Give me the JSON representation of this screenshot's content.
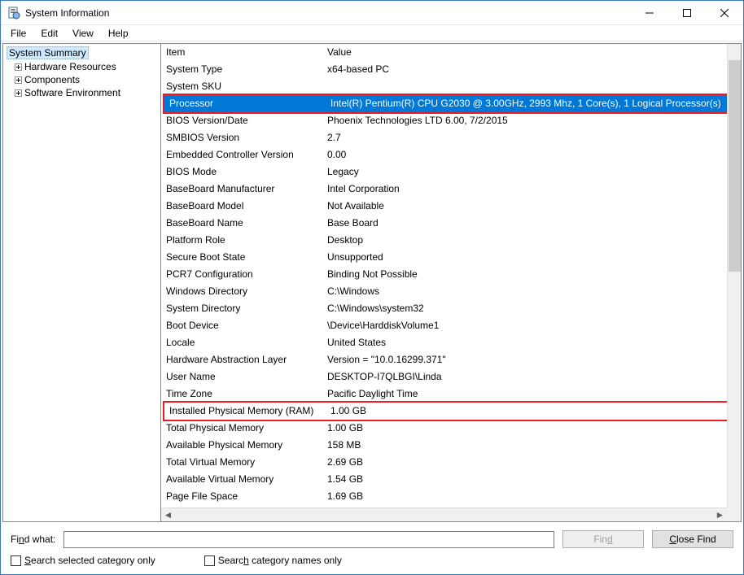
{
  "window": {
    "title": "System Information"
  },
  "menu": {
    "file": "File",
    "edit": "Edit",
    "view": "View",
    "help": "Help"
  },
  "tree": {
    "root": "System Summary",
    "children": [
      "Hardware Resources",
      "Components",
      "Software Environment"
    ]
  },
  "grid": {
    "header_item": "Item",
    "header_value": "Value",
    "rows": [
      {
        "item": "System Type",
        "value": "x64-based PC"
      },
      {
        "item": "System SKU",
        "value": ""
      },
      {
        "item": "Processor",
        "value": "Intel(R) Pentium(R) CPU G2030 @ 3.00GHz, 2993 Mhz, 1 Core(s), 1 Logical Processor(s)",
        "selected": true,
        "boxed": true
      },
      {
        "item": "BIOS Version/Date",
        "value": "Phoenix Technologies LTD 6.00, 7/2/2015"
      },
      {
        "item": "SMBIOS Version",
        "value": "2.7"
      },
      {
        "item": "Embedded Controller Version",
        "value": "0.00"
      },
      {
        "item": "BIOS Mode",
        "value": "Legacy"
      },
      {
        "item": "BaseBoard Manufacturer",
        "value": "Intel Corporation"
      },
      {
        "item": "BaseBoard Model",
        "value": "Not Available"
      },
      {
        "item": "BaseBoard Name",
        "value": "Base Board"
      },
      {
        "item": "Platform Role",
        "value": "Desktop"
      },
      {
        "item": "Secure Boot State",
        "value": "Unsupported"
      },
      {
        "item": "PCR7 Configuration",
        "value": "Binding Not Possible"
      },
      {
        "item": "Windows Directory",
        "value": "C:\\Windows"
      },
      {
        "item": "System Directory",
        "value": "C:\\Windows\\system32"
      },
      {
        "item": "Boot Device",
        "value": "\\Device\\HarddiskVolume1"
      },
      {
        "item": "Locale",
        "value": "United States"
      },
      {
        "item": "Hardware Abstraction Layer",
        "value": "Version = \"10.0.16299.371\""
      },
      {
        "item": "User Name",
        "value": "DESKTOP-I7QLBGI\\Linda"
      },
      {
        "item": "Time Zone",
        "value": "Pacific Daylight Time"
      },
      {
        "item": "Installed Physical Memory (RAM)",
        "value": "1.00 GB",
        "boxed": true
      },
      {
        "item": "Total Physical Memory",
        "value": "1.00 GB"
      },
      {
        "item": "Available Physical Memory",
        "value": "158 MB"
      },
      {
        "item": "Total Virtual Memory",
        "value": "2.69 GB"
      },
      {
        "item": "Available Virtual Memory",
        "value": "1.54 GB"
      },
      {
        "item": "Page File Space",
        "value": "1.69 GB"
      }
    ]
  },
  "find": {
    "label": "Find what:",
    "find_btn": "Find",
    "close_btn": "Close Find",
    "check_category": "Search selected category only",
    "check_names": "Search category names only"
  }
}
